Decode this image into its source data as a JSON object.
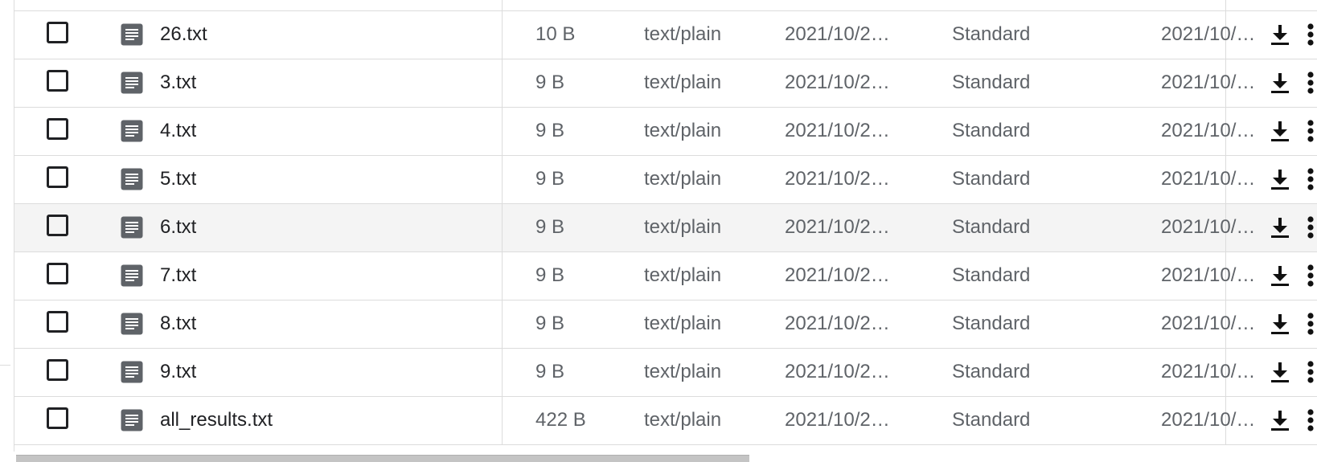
{
  "table": {
    "rows": [
      {
        "name": "26.txt",
        "size": "10 B",
        "type": "text/plain",
        "created": "2021/10/2…",
        "storage_class": "Standard",
        "updated": "2021/10/…",
        "highlighted": false
      },
      {
        "name": "3.txt",
        "size": "9 B",
        "type": "text/plain",
        "created": "2021/10/2…",
        "storage_class": "Standard",
        "updated": "2021/10/…",
        "highlighted": false
      },
      {
        "name": "4.txt",
        "size": "9 B",
        "type": "text/plain",
        "created": "2021/10/2…",
        "storage_class": "Standard",
        "updated": "2021/10/…",
        "highlighted": false
      },
      {
        "name": "5.txt",
        "size": "9 B",
        "type": "text/plain",
        "created": "2021/10/2…",
        "storage_class": "Standard",
        "updated": "2021/10/…",
        "highlighted": false
      },
      {
        "name": "6.txt",
        "size": "9 B",
        "type": "text/plain",
        "created": "2021/10/2…",
        "storage_class": "Standard",
        "updated": "2021/10/…",
        "highlighted": true
      },
      {
        "name": "7.txt",
        "size": "9 B",
        "type": "text/plain",
        "created": "2021/10/2…",
        "storage_class": "Standard",
        "updated": "2021/10/…",
        "highlighted": false
      },
      {
        "name": "8.txt",
        "size": "9 B",
        "type": "text/plain",
        "created": "2021/10/2…",
        "storage_class": "Standard",
        "updated": "2021/10/…",
        "highlighted": false
      },
      {
        "name": "9.txt",
        "size": "9 B",
        "type": "text/plain",
        "created": "2021/10/2…",
        "storage_class": "Standard",
        "updated": "2021/10/…",
        "highlighted": false
      },
      {
        "name": "all_results.txt",
        "size": "422 B",
        "type": "text/plain",
        "created": "2021/10/2…",
        "storage_class": "Standard",
        "updated": "2021/10/…",
        "highlighted": false
      }
    ]
  },
  "icons": {
    "file": "text-file-icon",
    "download": "download-icon",
    "more": "more-vertical-icon",
    "checkbox": "checkbox-unchecked"
  },
  "colors": {
    "text_primary": "#202124",
    "text_secondary": "#5f6368",
    "file_icon": "#5f6368",
    "row_highlight": "#f4f4f4",
    "divider": "#dcdcdc"
  }
}
